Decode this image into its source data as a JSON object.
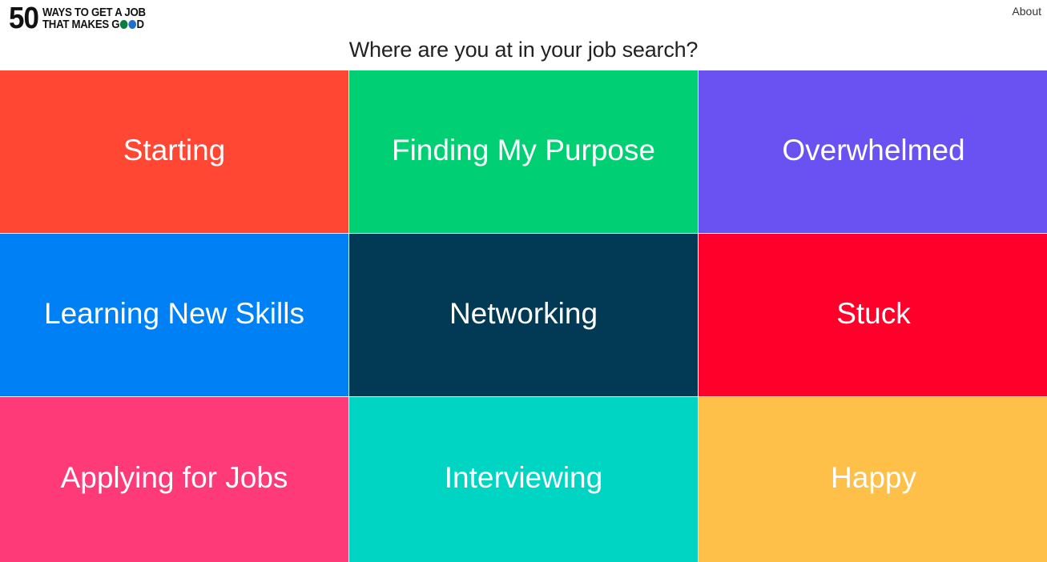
{
  "header": {
    "logo": {
      "number": "50",
      "line1": "WAYS TO GET A JOB",
      "line2_prefix": "THAT MAKES G",
      "line2_suffix": "D",
      "o_colors": [
        "#0a7d3e",
        "#1f6fd1"
      ]
    },
    "about_label": "About"
  },
  "page_title": "Where are you at in your job search?",
  "tiles": [
    {
      "label": "Starting",
      "color": "#ff4733"
    },
    {
      "label": "Finding My Purpose",
      "color": "#00d073"
    },
    {
      "label": "Overwhelmed",
      "color": "#6a52f2"
    },
    {
      "label": "Learning New Skills",
      "color": "#0080f5"
    },
    {
      "label": "Networking",
      "color": "#023a56"
    },
    {
      "label": "Stuck",
      "color": "#ff002b"
    },
    {
      "label": "Applying for Jobs",
      "color": "#ff3a78"
    },
    {
      "label": "Interviewing",
      "color": "#00d4c3"
    },
    {
      "label": "Happy",
      "color": "#ffc04a"
    }
  ]
}
